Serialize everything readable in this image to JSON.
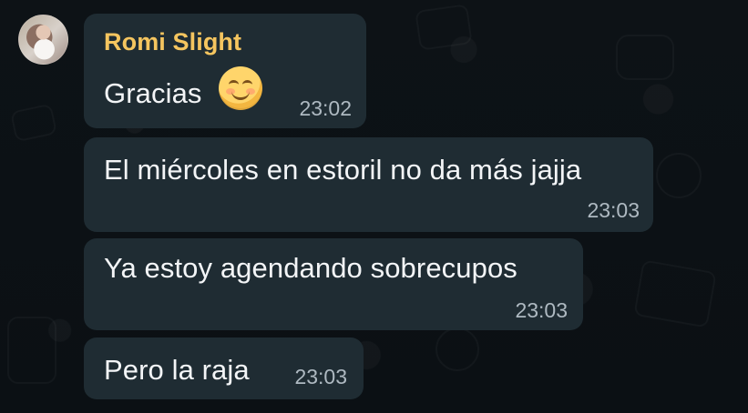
{
  "conversation": {
    "messages": [
      {
        "sender": "Romi Slight",
        "text": "Gracias",
        "time": "23:02",
        "emoji": "smiling-face-with-smiling-eyes"
      },
      {
        "text": "El miércoles en estoril no da más jajja",
        "time": "23:03"
      },
      {
        "text": "Ya estoy agendando sobrecupos",
        "time": "23:03"
      },
      {
        "text": "Pero la raja",
        "time": "23:03"
      }
    ]
  },
  "theme": {
    "background": "#0b141a",
    "bubble": "#1f2c33",
    "sender_color": "#f5c55f",
    "text_color": "#f3f5f7",
    "time_color": "#aeb9c1"
  }
}
